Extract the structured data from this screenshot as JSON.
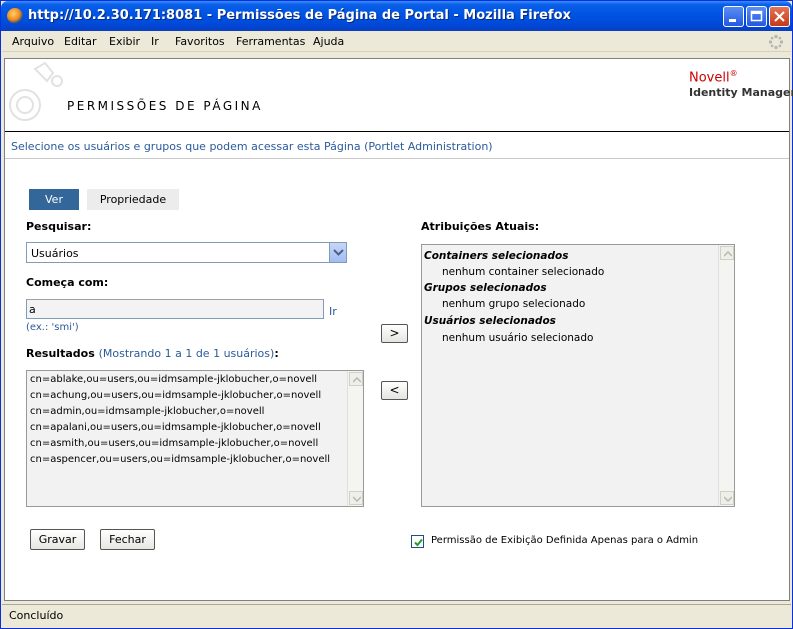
{
  "window": {
    "title": "http://10.2.30.171:8081 - Permissões de Página de Portal - Mozilla Firefox"
  },
  "menu": [
    {
      "label": "Arquivo"
    },
    {
      "label": "Editar"
    },
    {
      "label": "Exibir"
    },
    {
      "label": "Ir"
    },
    {
      "label": "Favoritos"
    },
    {
      "label": "Ferramentas"
    },
    {
      "label": "Ajuda"
    }
  ],
  "header": {
    "title": "PERMISSÕES DE PÁGINA",
    "brand": "Novell",
    "brand_mark": "®",
    "product": "Identity Manager"
  },
  "instruction": "Selecione os usuários e grupos que podem acessar esta Página (Portlet Administration)",
  "tabs": [
    {
      "label": "Ver",
      "active": true
    },
    {
      "label": "Propriedade",
      "active": false
    }
  ],
  "search": {
    "label": "Pesquisar:",
    "selected": "Usuários",
    "starts_with_label": "Começa com:",
    "value": "a",
    "go_label": "Ir",
    "hint": "(ex.: 'smi')"
  },
  "results": {
    "label": "Resultados",
    "info": "(Mostrando 1 a 1 de 1 usuários)",
    "label_suffix": ":",
    "items": [
      "cn=ablake,ou=users,ou=idmsample-jklobucher,o=novell",
      "cn=achung,ou=users,ou=idmsample-jklobucher,o=novell",
      "cn=admin,ou=idmsample-jklobucher,o=novell",
      "cn=apalani,ou=users,ou=idmsample-jklobucher,o=novell",
      "cn=asmith,ou=users,ou=idmsample-jklobucher,o=novell",
      "cn=aspencer,ou=users,ou=idmsample-jklobucher,o=novell"
    ]
  },
  "move": {
    "add": ">",
    "remove": "<"
  },
  "assignments": {
    "label": "Atribuições Atuais:",
    "groups": [
      {
        "header": "Containers selecionados",
        "item": "nenhum container selecionado"
      },
      {
        "header": "Grupos selecionados",
        "item": "nenhum grupo selecionado"
      },
      {
        "header": "Usuários selecionados",
        "item": "nenhum usuário selecionado"
      }
    ]
  },
  "buttons": {
    "save": "Gravar",
    "close": "Fechar"
  },
  "admin_only": {
    "label": "Permissão de Exibição Definida Apenas para o Admin",
    "checked": true
  },
  "status": "Concluído"
}
